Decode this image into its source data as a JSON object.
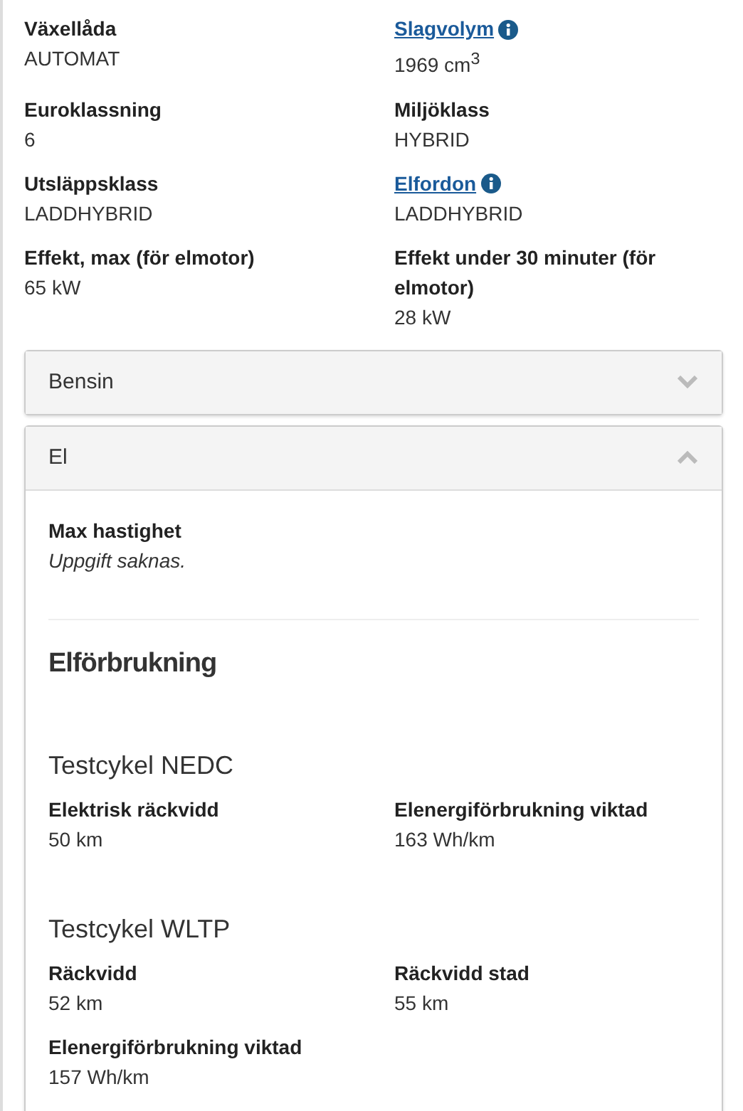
{
  "specs": [
    {
      "label": "Växellåda",
      "kind": "plain",
      "value": "AUTOMAT"
    },
    {
      "label": "Slagvolym",
      "kind": "link",
      "value": "1969 cm$^{3}$"
    },
    {
      "label": "Euroklassning",
      "kind": "plain",
      "value": "6"
    },
    {
      "label": "Miljöklass",
      "kind": "plain",
      "value": "HYBRID"
    },
    {
      "label": "Utsläppsklass",
      "kind": "plain",
      "value": "LADDHYBRID"
    },
    {
      "label": "Elfordon",
      "kind": "link",
      "value": "LADDHYBRID"
    },
    {
      "label": "Effekt, max (för elmotor)",
      "kind": "plain",
      "value": "65 kW"
    },
    {
      "label": "Effekt under 30 minuter (för elmotor)",
      "kind": "plain",
      "value": "28 kW"
    }
  ],
  "accordions": [
    {
      "title": "Bensin",
      "expanded": false
    },
    {
      "title": "El",
      "expanded": true,
      "fields": [
        {
          "label": "Max hastighet",
          "value": "Uppgift saknas.",
          "missing": true
        }
      ],
      "heading": "Elförbrukning",
      "sections": [
        {
          "title": "Testcykel NEDC",
          "fields": [
            {
              "label": "Elektrisk räckvidd",
              "value": "50 km",
              "missing": false
            },
            {
              "label": "Elenergiförbrukning viktad",
              "value": "163 Wh/km",
              "missing": false
            }
          ]
        },
        {
          "title": "Testcykel WLTP",
          "fields": [
            {
              "label": "Räckvidd",
              "value": "52 km",
              "missing": false
            },
            {
              "label": "Räckvidd stad",
              "value": "55 km",
              "missing": false
            },
            {
              "label": "Elenergiförbrukning viktad",
              "value": "157 Wh/km",
              "missing": false
            }
          ]
        }
      ]
    }
  ]
}
